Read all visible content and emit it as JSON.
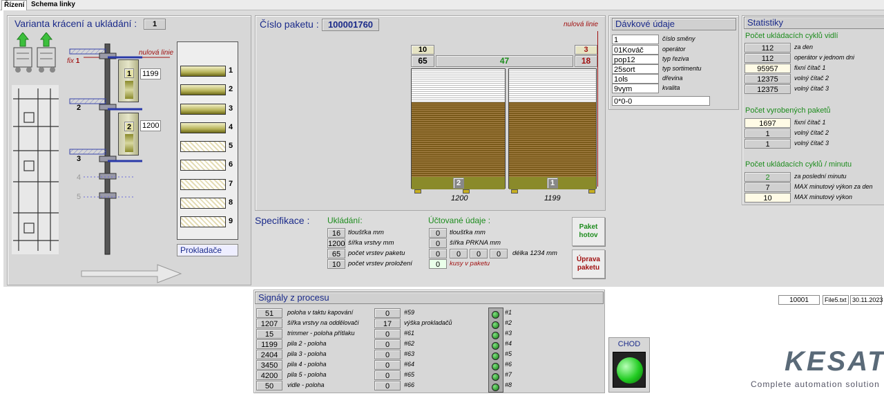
{
  "tabs": [
    "Řízení",
    "Schema linky"
  ],
  "left": {
    "title": "Varianta krácení a ukládání :",
    "variant": "1",
    "nulova": "nulová linie",
    "fix_prefix": "fix",
    "fix_num": "1",
    "levels": [
      "2",
      "3",
      "4",
      "5"
    ],
    "carriers": [
      {
        "num": "1",
        "value": "1199"
      },
      {
        "num": "2",
        "value": "1200"
      }
    ],
    "stack_nums": [
      "1",
      "2",
      "3",
      "4",
      "5",
      "6",
      "7",
      "8",
      "9"
    ],
    "prokladace": "Prokladače"
  },
  "paket": {
    "title": "Číslo paketu :",
    "number": "100001760",
    "nulova": "nulová linie",
    "top_left": "10",
    "top_right": "3",
    "left_count": "65",
    "center_count": "47",
    "right_count": "18",
    "left_stack_no": "2",
    "right_stack_no": "1",
    "left_len": "1200",
    "right_len": "1199"
  },
  "spec": {
    "title": "Specifikace :",
    "ukladani_title": "Ukládání:",
    "ukladani": [
      {
        "v": "16",
        "l": "tloušťka  mm"
      },
      {
        "v": "1200",
        "l": "šířka vrstvy  mm"
      },
      {
        "v": "65",
        "l": "počet vrstev paketu"
      },
      {
        "v": "10",
        "l": "počet vrstev proložení"
      }
    ],
    "uctovane_title": "Účtované údaje :",
    "uctovane": [
      {
        "v": "0",
        "l": "tloušťka  mm"
      },
      {
        "v": "0",
        "l": "šířka PRKNA  mm"
      }
    ],
    "delka_vals": [
      "0",
      "0",
      "0",
      "0"
    ],
    "delka_label": "délka 1234 mm",
    "kusy_val": "0",
    "kusy_label": "kusy v paketu"
  },
  "buttons": {
    "paket_hotov": [
      "Paket",
      "hotov"
    ],
    "uprava": [
      "Úprava",
      "paketu"
    ]
  },
  "davkove": {
    "title": "Dávkové údaje",
    "rows": [
      {
        "v": "1",
        "l": "číslo směny"
      },
      {
        "v": "01Kováč",
        "l": "operátor"
      },
      {
        "v": "pop12",
        "l": "typ řeziva"
      },
      {
        "v": "25sort",
        "l": "typ sortimentu"
      },
      {
        "v": "1ols",
        "l": "dřevina"
      },
      {
        "v": "9vym",
        "l": "kvalita"
      }
    ],
    "extra": "0*0-0"
  },
  "stat": {
    "title": "Statistiky",
    "g1_title": "Počet ukládacích cyklů vidlí",
    "g1": [
      {
        "v": "112",
        "l": "za den"
      },
      {
        "v": "112",
        "l": "operátor v jednom dni"
      },
      {
        "v": "95957",
        "l": "fixní čítač 1"
      },
      {
        "v": "12375",
        "l": "volný čítač 2"
      },
      {
        "v": "12375",
        "l": "volný čítač 3"
      }
    ],
    "g2_title": "Počet vyrobených paketů",
    "g2": [
      {
        "v": "1697",
        "l": "fixní čítač 1"
      },
      {
        "v": "1",
        "l": "volný čítač 2"
      },
      {
        "v": "1",
        "l": "volný čítač 3"
      }
    ],
    "g3_title": "Počet ukládacích cyklů / minutu",
    "g3": [
      {
        "v": "2",
        "l": "za poslední minutu"
      },
      {
        "v": "7",
        "l": "MAX minutový výkon za den"
      },
      {
        "v": "10",
        "l": "MAX minutový výkon"
      }
    ]
  },
  "signals": {
    "title": "Signály z procesu",
    "col1": [
      {
        "v": "51",
        "l": "poloha v taktu kapování"
      },
      {
        "v": "1207",
        "l": "šířka vrstvy na oddělovači"
      },
      {
        "v": "15",
        "l": "trimmer - poloha přítlaku"
      },
      {
        "v": "1199",
        "l": "pila 2 - poloha"
      },
      {
        "v": "2404",
        "l": "pila 3 - poloha"
      },
      {
        "v": "3450",
        "l": "pila 4 - poloha"
      },
      {
        "v": "4200",
        "l": "pila 5 - poloha"
      },
      {
        "v": "50",
        "l": "vidle - poloha"
      }
    ],
    "col2": [
      {
        "v": "0",
        "l": "#59"
      },
      {
        "v": "17",
        "l": "výška prokladačů"
      },
      {
        "v": "0",
        "l": "#61"
      },
      {
        "v": "0",
        "l": "#62"
      },
      {
        "v": "0",
        "l": "#63"
      },
      {
        "v": "0",
        "l": "#64"
      },
      {
        "v": "0",
        "l": "#65"
      },
      {
        "v": "0",
        "l": "#66"
      }
    ],
    "leds": [
      "#1",
      "#2",
      "#3",
      "#4",
      "#5",
      "#6",
      "#7",
      "#8"
    ]
  },
  "status": {
    "counter": "10001",
    "file": "File5.txt",
    "date": "30.11.2023"
  },
  "chod": {
    "label": "CHOD"
  },
  "brand": {
    "name": "KESAT",
    "tagline": "Complete automation solution"
  },
  "colors": {
    "title_blue": "#1a2a8a",
    "group_green": "#1d8c1d",
    "alert_red": "#a01010",
    "wood_brown": "#7a5a1a",
    "led_green": "#22cc22"
  }
}
